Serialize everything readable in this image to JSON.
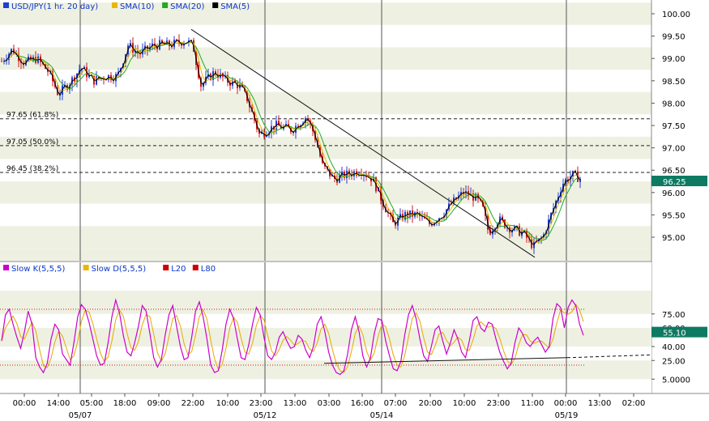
{
  "chart_data": {
    "type": "candlestick",
    "main_panel": {
      "legend": [
        {
          "label": "USD/JPY(1 hr.  20 day)",
          "color": "#1f3fd0"
        },
        {
          "label": "SMA(10)",
          "color": "#e8b800"
        },
        {
          "label": "SMA(20)",
          "color": "#22aa22"
        },
        {
          "label": "SMA(5)",
          "color": "#000000"
        }
      ],
      "y_ticks": [
        95.0,
        95.5,
        96.0,
        96.5,
        97.0,
        97.5,
        98.0,
        98.5,
        99.0,
        99.5,
        100.0
      ],
      "y_tick_labels": [
        "95.00",
        "95.50",
        "96.00",
        "96.50",
        "97.00",
        "97.50",
        "98.00",
        "98.50",
        "99.00",
        "99.50",
        "100.00"
      ],
      "ylim": [
        94.3,
        100.2
      ],
      "current_price": {
        "value": 96.25,
        "label": "96.25"
      },
      "fib_levels": [
        {
          "value": 97.65,
          "label": "97.65 (61.8%)"
        },
        {
          "value": 97.05,
          "label": "97.05 (50.0%)"
        },
        {
          "value": 96.45,
          "label": "96.45 (38.2%)"
        }
      ],
      "trendline": {
        "from": [
          236,
          99.65
        ],
        "to": [
          660,
          94.55
        ]
      },
      "ohlc_anchors": [
        [
          0,
          98.9
        ],
        [
          15,
          99.2
        ],
        [
          30,
          98.9
        ],
        [
          45,
          99.0
        ],
        [
          60,
          98.7
        ],
        [
          72,
          98.2
        ],
        [
          88,
          98.5
        ],
        [
          100,
          98.8
        ],
        [
          115,
          98.5
        ],
        [
          130,
          98.6
        ],
        [
          145,
          98.6
        ],
        [
          158,
          99.3
        ],
        [
          172,
          99.1
        ],
        [
          190,
          99.3
        ],
        [
          210,
          99.3
        ],
        [
          228,
          99.4
        ],
        [
          238,
          99.3
        ],
        [
          248,
          98.4
        ],
        [
          265,
          98.7
        ],
        [
          280,
          98.5
        ],
        [
          295,
          98.4
        ],
        [
          305,
          98.1
        ],
        [
          320,
          97.3
        ],
        [
          340,
          97.5
        ],
        [
          360,
          97.4
        ],
        [
          378,
          97.7
        ],
        [
          388,
          97.3
        ],
        [
          398,
          96.6
        ],
        [
          412,
          96.3
        ],
        [
          428,
          96.4
        ],
        [
          445,
          96.5
        ],
        [
          460,
          96.3
        ],
        [
          472,
          95.8
        ],
        [
          485,
          95.3
        ],
        [
          500,
          95.5
        ],
        [
          515,
          95.5
        ],
        [
          530,
          95.3
        ],
        [
          545,
          95.5
        ],
        [
          560,
          95.8
        ],
        [
          572,
          96.0
        ],
        [
          585,
          95.9
        ],
        [
          595,
          95.7
        ],
        [
          603,
          95.1
        ],
        [
          615,
          95.4
        ],
        [
          630,
          95.2
        ],
        [
          645,
          95.1
        ],
        [
          658,
          94.8
        ],
        [
          670,
          95.0
        ],
        [
          682,
          95.6
        ],
        [
          694,
          96.2
        ],
        [
          706,
          96.4
        ],
        [
          718,
          96.3
        ]
      ]
    },
    "oscillator_panel": {
      "legend": [
        {
          "label": "Slow K(5,5,5)",
          "color": "#cc00cc"
        },
        {
          "label": "Slow D(5,5,5)",
          "color": "#e8b800"
        },
        {
          "label": "L20",
          "color": "#cc0000"
        },
        {
          "label": "L80",
          "color": "#cc0000"
        }
      ],
      "y_ticks": [
        5,
        25,
        40,
        60,
        75
      ],
      "y_tick_labels": [
        "5.0000",
        "25.00",
        "40.00",
        "60.00",
        "75.00"
      ],
      "ylim": [
        0,
        100
      ],
      "current_value": {
        "value": 55.1,
        "label": "55.10"
      },
      "levels": {
        "L80": 80,
        "L20": 20
      },
      "k_values": [
        46,
        74,
        80,
        64,
        50,
        38,
        56,
        78,
        64,
        28,
        18,
        12,
        22,
        48,
        64,
        58,
        32,
        26,
        20,
        44,
        72,
        85,
        80,
        66,
        48,
        30,
        20,
        22,
        44,
        72,
        90,
        76,
        52,
        34,
        30,
        44,
        62,
        84,
        78,
        54,
        28,
        18,
        26,
        52,
        74,
        84,
        62,
        40,
        26,
        28,
        50,
        78,
        88,
        72,
        48,
        20,
        12,
        14,
        36,
        64,
        80,
        70,
        48,
        28,
        26,
        42,
        64,
        82,
        74,
        50,
        30,
        26,
        34,
        50,
        56,
        46,
        38,
        40,
        52,
        48,
        36,
        28,
        40,
        64,
        72,
        56,
        34,
        20,
        12,
        10,
        14,
        32,
        58,
        72,
        56,
        30,
        18,
        28,
        54,
        70,
        68,
        46,
        30,
        16,
        14,
        24,
        52,
        74,
        84,
        70,
        48,
        30,
        24,
        40,
        58,
        62,
        46,
        32,
        44,
        58,
        48,
        34,
        28,
        46,
        68,
        72,
        60,
        56,
        66,
        64,
        48,
        34,
        24,
        16,
        22,
        44,
        60,
        54,
        44,
        40,
        46,
        50,
        42,
        34,
        40,
        70,
        86,
        82,
        60,
        82,
        90,
        84,
        64,
        52
      ]
    },
    "x_axis": {
      "ticks": [
        "00:00",
        "14:00",
        "05:00",
        "18:00",
        "09:00",
        "22:00",
        "10:00",
        "23:00",
        "13:00",
        "03:00",
        "16:00",
        "07:00",
        "20:00",
        "10:00",
        "23:00",
        "11:00",
        "00:00",
        "13:00",
        "02:00"
      ],
      "dates": [
        {
          "label": "05/07",
          "at": "05:00"
        },
        {
          "label": "05/12",
          "at": "23:00"
        },
        {
          "label": "05/14",
          "at": "16:00"
        },
        {
          "label": "05/19",
          "at": "00:00"
        }
      ]
    },
    "colors": {
      "up": "#1f3fd0",
      "down": "#d01818",
      "band": "#eef1e2",
      "sma10": "#e8b800",
      "sma20": "#22aa22",
      "sma5": "#000000",
      "badge": "#0e7a62"
    }
  }
}
